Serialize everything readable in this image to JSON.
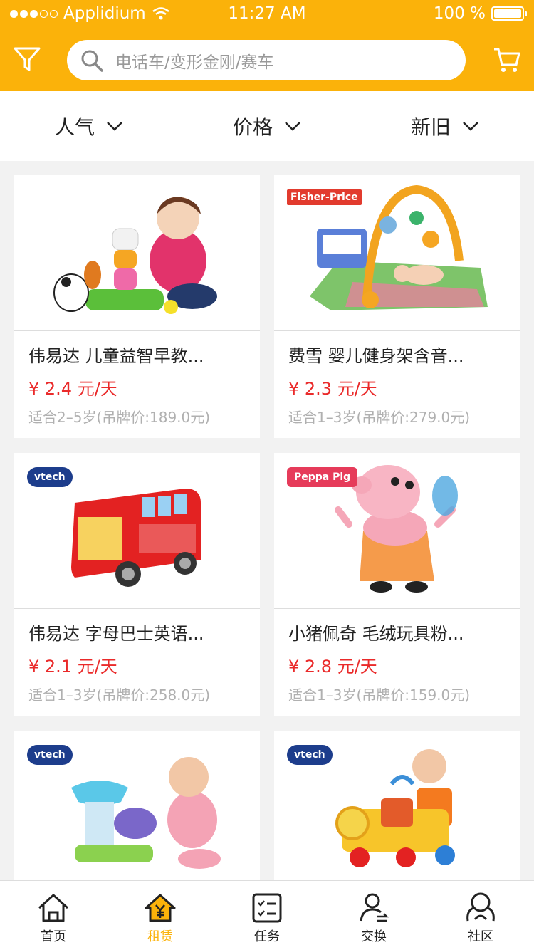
{
  "status_bar": {
    "carrier": "Applidium",
    "time": "11:27 AM",
    "battery": "100 %"
  },
  "search": {
    "placeholder": "电话车/变形金刚/赛车"
  },
  "sort_options": [
    {
      "label": "人气"
    },
    {
      "label": "价格"
    },
    {
      "label": "新旧"
    }
  ],
  "products": [
    {
      "title": "伟易达 儿童益智早教...",
      "price": "¥ 2.4 元/天",
      "meta": "适合2–5岁(吊牌价:189.0元)"
    },
    {
      "title": "费雪 婴儿健身架含音...",
      "price": "¥ 2.3 元/天",
      "meta": "适合1–3岁(吊牌价:279.0元)",
      "brand": "Fisher-Price"
    },
    {
      "title": "伟易达 字母巴士英语...",
      "price": "¥ 2.1 元/天",
      "meta": "适合1–3岁(吊牌价:258.0元)",
      "brand": "vtech"
    },
    {
      "title": "小猪佩奇 毛绒玩具粉...",
      "price": "¥ 2.8 元/天",
      "meta": "适合1–3岁(吊牌价:159.0元)",
      "brand": "Peppa Pig"
    },
    {
      "brand": "vtech"
    },
    {
      "brand": "vtech"
    }
  ],
  "tabs": [
    {
      "label": "首页",
      "icon": "home-icon"
    },
    {
      "label": "租赁",
      "icon": "rent-icon",
      "active": true
    },
    {
      "label": "任务",
      "icon": "task-icon"
    },
    {
      "label": "交换",
      "icon": "exchange-icon"
    },
    {
      "label": "社区",
      "icon": "community-icon"
    }
  ],
  "colors": {
    "accent": "#fbb20a",
    "price": "#ea2a2a"
  }
}
